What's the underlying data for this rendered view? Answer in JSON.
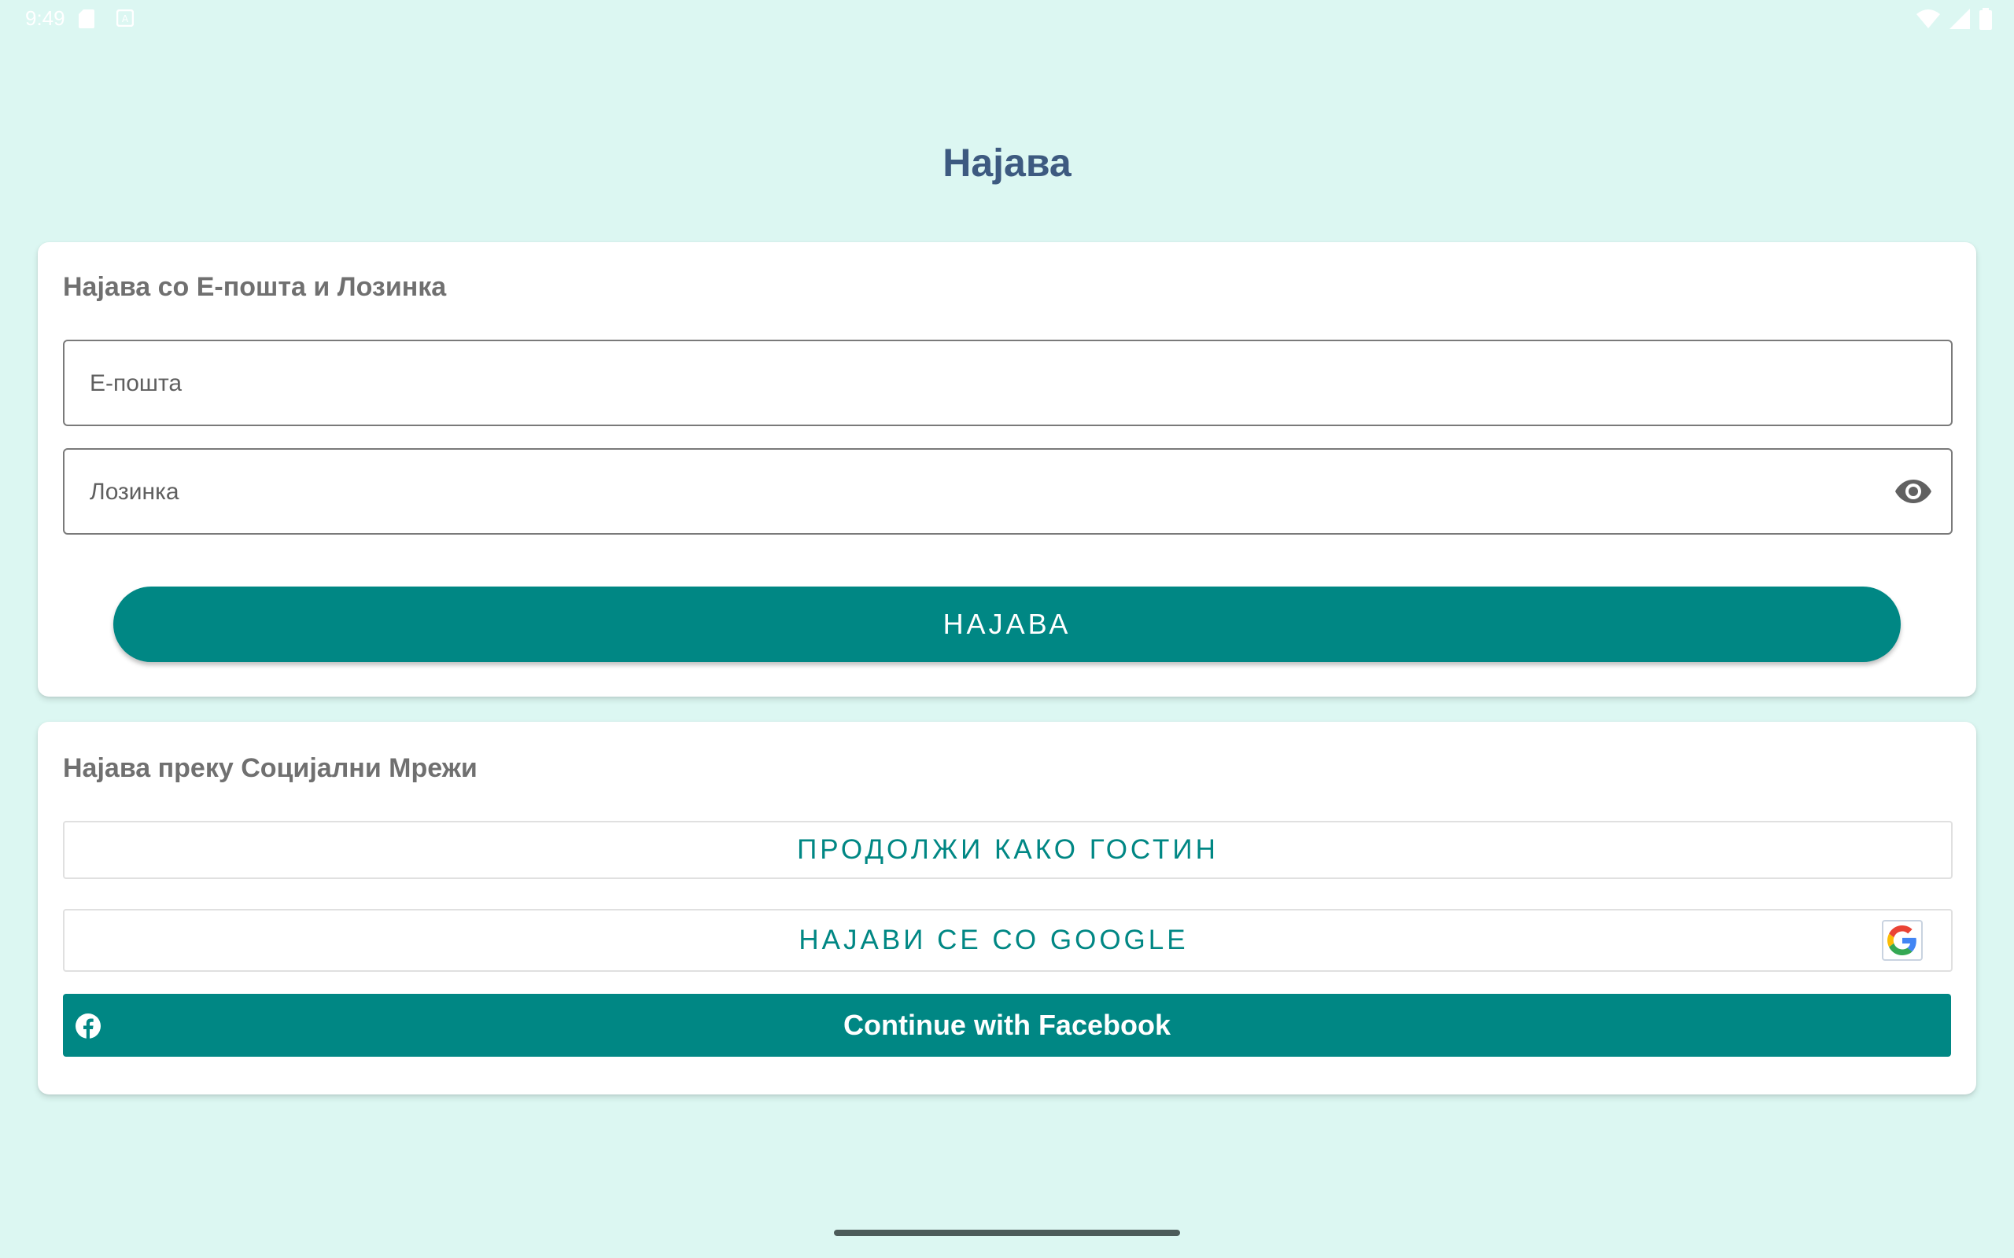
{
  "status_bar": {
    "time": "9:49",
    "left_icons": [
      "sd-card-icon",
      "notification-icon"
    ],
    "right_icons": [
      "wifi-icon",
      "signal-icon",
      "battery-icon"
    ]
  },
  "page": {
    "title": "Најава"
  },
  "email_login": {
    "heading": "Најава со Е-пошта и Лозинка",
    "email_placeholder": "Е-пошта",
    "email_value": "",
    "password_placeholder": "Лозинка",
    "password_value": "",
    "password_toggle_icon": "eye-icon",
    "submit_label": "НАЈАВА"
  },
  "social_login": {
    "heading": "Најава преку Социјални Мрежи",
    "guest_label": "ПРОДОЛЖИ КАКО ГОСТИН",
    "google_label": "НАЈАВИ СЕ СО GOOGLE",
    "google_icon": "google-icon",
    "facebook_label": "Continue with Facebook",
    "facebook_icon": "facebook-icon"
  },
  "colors": {
    "background": "#dcf7f2",
    "accent": "#008784",
    "title": "#3d5a80",
    "card": "#ffffff",
    "heading_text": "#707070"
  }
}
